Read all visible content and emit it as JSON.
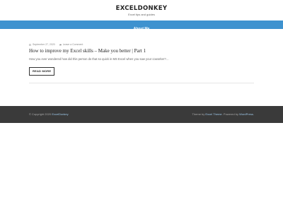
{
  "site": {
    "title": "EXCELDONKEY",
    "tagline": "Excel tips and guides"
  },
  "nav": {
    "items": [
      {
        "label": "About Me"
      }
    ]
  },
  "post": {
    "date": "September 27, 2020",
    "comment": "Leave a Comment",
    "title": "How to improve my Excel skills – Make you better | Part 1",
    "excerpt": "How you ever wondered how did this person do that so quick in MS Excel when you saw your coworker?…",
    "read_more": "READ MORE"
  },
  "footer": {
    "copyright_prefix": "© Copyright 2020",
    "copyright_site": "ExcelDonkey",
    "theme_prefix": "Theme by",
    "theme_name": "Excel Theme",
    "powered_prefix": ". Powered by",
    "powered_name": "WordPress",
    "powered_suffix": "."
  },
  "colors": {
    "nav_bg": "#3e92cf",
    "footer_bg": "#3a3a3a"
  }
}
